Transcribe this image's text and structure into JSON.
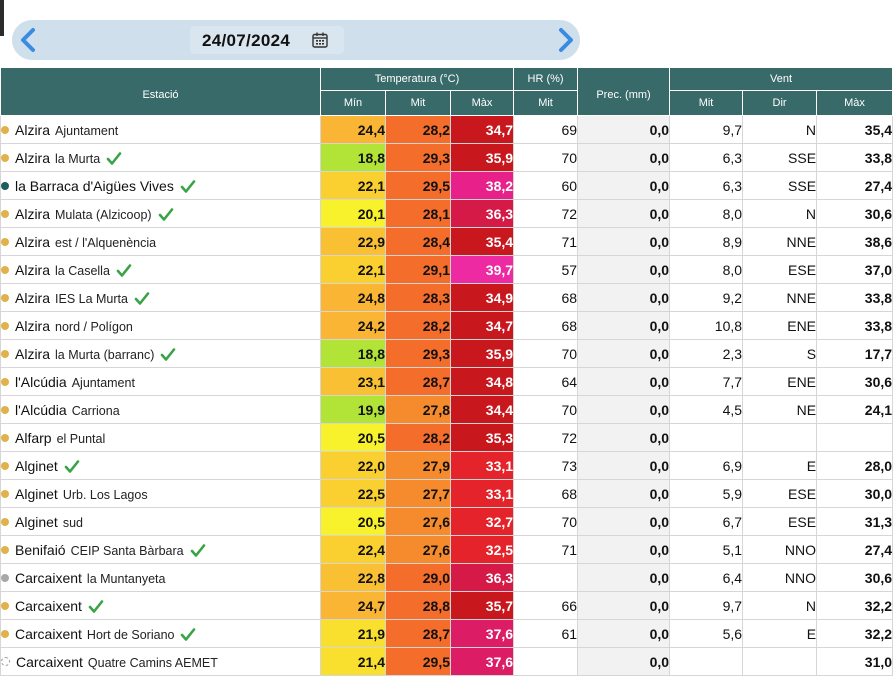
{
  "nav": {
    "date": "24/07/2024",
    "prev_icon": "chevron-left-icon",
    "next_icon": "chevron-right-icon",
    "calendar_icon": "calendar-icon"
  },
  "header": {
    "station": "Estació",
    "temperature": "Temperatura (°C)",
    "hr": "HR (%)",
    "prec": "Prec. (mm)",
    "wind": "Vent",
    "min": "Mín",
    "mit": "Mit",
    "max": "Màx",
    "hr_mit": "Mit",
    "wind_mit": "Mit",
    "dir": "Dir",
    "wind_max": "Màx"
  },
  "colors": {
    "header_bg": "#386a6a",
    "dot_yellow": "#e0b24a",
    "dot_teal": "#1d5e5c",
    "dot_gray": "#a8a8a8",
    "check_green": "#3aa346"
  },
  "rows": [
    {
      "dot": "yellow",
      "name": "Alzira",
      "sub": "Ajuntament",
      "check": false,
      "min": "24,4",
      "mit": "28,2",
      "max": "34,7",
      "min_color": "#f9b533",
      "mit_color": "#f46d2a",
      "max_color": "#c9171e",
      "hr": "69",
      "prec": "0,0",
      "wind_mit": "9,7",
      "dir": "N",
      "wind_max": "35,4"
    },
    {
      "dot": "yellow",
      "name": "Alzira",
      "sub": "la Murta",
      "check": true,
      "min": "18,8",
      "mit": "29,3",
      "max": "35,9",
      "min_color": "#b2e437",
      "mit_color": "#f46d2a",
      "max_color": "#c9171e",
      "hr": "70",
      "prec": "0,0",
      "wind_mit": "6,3",
      "dir": "SSE",
      "wind_max": "33,8"
    },
    {
      "dot": "teal",
      "name": "la Barraca d'Aigües Vives",
      "sub": "",
      "check": true,
      "min": "22,1",
      "mit": "29,5",
      "max": "38,2",
      "min_color": "#f9d030",
      "mit_color": "#f46d2a",
      "max_color": "#e8208a",
      "hr": "60",
      "prec": "0,0",
      "wind_mit": "6,3",
      "dir": "SSE",
      "wind_max": "27,4"
    },
    {
      "dot": "yellow",
      "name": "Alzira",
      "sub": "Mulata (Alzicoop)",
      "check": true,
      "min": "20,1",
      "mit": "28,1",
      "max": "36,3",
      "min_color": "#f8f22c",
      "mit_color": "#f46d2a",
      "max_color": "#d51a48",
      "hr": "72",
      "prec": "0,0",
      "wind_mit": "8,0",
      "dir": "N",
      "wind_max": "30,6"
    },
    {
      "dot": "yellow",
      "name": "Alzira",
      "sub": "est / l'Alquenència",
      "check": false,
      "min": "22,9",
      "mit": "28,4",
      "max": "35,4",
      "min_color": "#f9c033",
      "mit_color": "#f46d2a",
      "max_color": "#c9171e",
      "hr": "71",
      "prec": "0,0",
      "wind_mit": "8,9",
      "dir": "NNE",
      "wind_max": "38,6"
    },
    {
      "dot": "yellow",
      "name": "Alzira",
      "sub": "la Casella",
      "check": true,
      "min": "22,1",
      "mit": "29,1",
      "max": "39,7",
      "min_color": "#f9d030",
      "mit_color": "#f46d2a",
      "max_color": "#ee2aa2",
      "hr": "57",
      "prec": "0,0",
      "wind_mit": "8,0",
      "dir": "ESE",
      "wind_max": "37,0"
    },
    {
      "dot": "yellow",
      "name": "Alzira",
      "sub": "IES La Murta",
      "check": true,
      "min": "24,8",
      "mit": "28,3",
      "max": "34,9",
      "min_color": "#f9b533",
      "mit_color": "#f46d2a",
      "max_color": "#c9171e",
      "hr": "68",
      "prec": "0,0",
      "wind_mit": "9,2",
      "dir": "NNE",
      "wind_max": "33,8"
    },
    {
      "dot": "yellow",
      "name": "Alzira",
      "sub": "nord / Polígon",
      "check": false,
      "min": "24,2",
      "mit": "28,2",
      "max": "34,7",
      "min_color": "#f9b533",
      "mit_color": "#f46d2a",
      "max_color": "#c9171e",
      "hr": "68",
      "prec": "0,0",
      "wind_mit": "10,8",
      "dir": "ENE",
      "wind_max": "33,8"
    },
    {
      "dot": "yellow",
      "name": "Alzira",
      "sub": "la Murta (barranc)",
      "check": true,
      "min": "18,8",
      "mit": "29,3",
      "max": "35,9",
      "min_color": "#b2e437",
      "mit_color": "#f46d2a",
      "max_color": "#c9171e",
      "hr": "70",
      "prec": "0,0",
      "wind_mit": "2,3",
      "dir": "S",
      "wind_max": "17,7"
    },
    {
      "dot": "yellow",
      "name": "l'Alcúdia",
      "sub": "Ajuntament",
      "check": false,
      "min": "23,1",
      "mit": "28,7",
      "max": "34,8",
      "min_color": "#f9c033",
      "mit_color": "#f46d2a",
      "max_color": "#c9171e",
      "hr": "64",
      "prec": "0,0",
      "wind_mit": "7,7",
      "dir": "ENE",
      "wind_max": "30,6"
    },
    {
      "dot": "yellow",
      "name": "l'Alcúdia",
      "sub": "Carriona",
      "check": false,
      "min": "19,9",
      "mit": "27,8",
      "max": "34,4",
      "min_color": "#b2e437",
      "mit_color": "#f58b2c",
      "max_color": "#c9171e",
      "hr": "70",
      "prec": "0,0",
      "wind_mit": "4,5",
      "dir": "NE",
      "wind_max": "24,1"
    },
    {
      "dot": "yellow",
      "name": "Alfarp",
      "sub": "el Puntal",
      "check": false,
      "min": "20,5",
      "mit": "28,2",
      "max": "35,3",
      "min_color": "#f8f22c",
      "mit_color": "#f46d2a",
      "max_color": "#c9171e",
      "hr": "72",
      "prec": "0,0",
      "wind_mit": "",
      "dir": "",
      "wind_max": ""
    },
    {
      "dot": "yellow",
      "name": "Alginet",
      "sub": "",
      "check": true,
      "min": "22,0",
      "mit": "27,9",
      "max": "33,1",
      "min_color": "#f9d030",
      "mit_color": "#f58b2c",
      "max_color": "#e4232a",
      "hr": "73",
      "prec": "0,0",
      "wind_mit": "6,9",
      "dir": "E",
      "wind_max": "28,0"
    },
    {
      "dot": "yellow",
      "name": "Alginet",
      "sub": "Urb. Los Lagos",
      "check": false,
      "min": "22,5",
      "mit": "27,7",
      "max": "33,1",
      "min_color": "#f9d030",
      "mit_color": "#f58b2c",
      "max_color": "#e4232a",
      "hr": "68",
      "prec": "0,0",
      "wind_mit": "5,9",
      "dir": "ESE",
      "wind_max": "30,0"
    },
    {
      "dot": "yellow",
      "name": "Alginet",
      "sub": "sud",
      "check": false,
      "min": "20,5",
      "mit": "27,6",
      "max": "32,7",
      "min_color": "#f8f22c",
      "mit_color": "#f58b2c",
      "max_color": "#e4232a",
      "hr": "70",
      "prec": "0,0",
      "wind_mit": "6,7",
      "dir": "ESE",
      "wind_max": "31,3"
    },
    {
      "dot": "yellow",
      "name": "Benifaió",
      "sub": "CEIP Santa Bàrbara",
      "check": true,
      "min": "22,4",
      "mit": "27,6",
      "max": "32,5",
      "min_color": "#f9d030",
      "mit_color": "#f58b2c",
      "max_color": "#e4232a",
      "hr": "71",
      "prec": "0,0",
      "wind_mit": "5,1",
      "dir": "NNO",
      "wind_max": "27,4"
    },
    {
      "dot": "gray",
      "name": "Carcaixent",
      "sub": "la Muntanyeta",
      "check": false,
      "min": "22,8",
      "mit": "29,0",
      "max": "36,3",
      "min_color": "#f9c033",
      "mit_color": "#f46d2a",
      "max_color": "#d51a48",
      "hr": "",
      "prec": "0,0",
      "wind_mit": "6,4",
      "dir": "NNO",
      "wind_max": "30,6"
    },
    {
      "dot": "yellow",
      "name": "Carcaixent",
      "sub": "",
      "check": true,
      "min": "24,7",
      "mit": "28,8",
      "max": "35,7",
      "min_color": "#f9b533",
      "mit_color": "#f46d2a",
      "max_color": "#c9171e",
      "hr": "66",
      "prec": "0,0",
      "wind_mit": "9,7",
      "dir": "N",
      "wind_max": "32,2"
    },
    {
      "dot": "yellow",
      "name": "Carcaixent",
      "sub": "Hort de Soriano",
      "check": true,
      "min": "21,9",
      "mit": "28,7",
      "max": "37,6",
      "min_color": "#f9e02e",
      "mit_color": "#f46d2a",
      "max_color": "#dd1c66",
      "hr": "61",
      "prec": "0,0",
      "wind_mit": "5,6",
      "dir": "E",
      "wind_max": "32,2"
    },
    {
      "dot": "empty",
      "name": "Carcaixent",
      "sub": "Quatre Camins AEMET",
      "check": false,
      "min": "21,4",
      "mit": "29,5",
      "max": "37,6",
      "min_color": "#f9e02e",
      "mit_color": "#f46d2a",
      "max_color": "#dd1c66",
      "hr": "",
      "prec": "0,0",
      "wind_mit": "",
      "dir": "",
      "wind_max": "31,0"
    }
  ]
}
